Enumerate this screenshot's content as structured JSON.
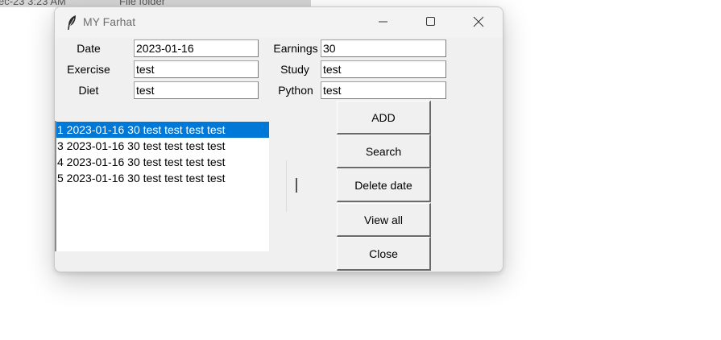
{
  "background": {
    "explorer_date": "ec-23 3:23 AM",
    "explorer_type": "File folder"
  },
  "window": {
    "title": "MY Farhat",
    "controls": {
      "minimize": "minimize-icon",
      "maximize": "maximize-icon",
      "close": "close-icon"
    }
  },
  "form": {
    "date": {
      "label": "Date",
      "value": "2023-01-16"
    },
    "exercise": {
      "label": "Exercise",
      "value": "test"
    },
    "diet": {
      "label": "Diet",
      "value": "test"
    },
    "earnings": {
      "label": "Earnings",
      "value": "30"
    },
    "study": {
      "label": "Study",
      "value": "test"
    },
    "python": {
      "label": "Python",
      "value": "test"
    }
  },
  "listbox": {
    "selected_index": 0,
    "items": [
      "1 2023-01-16 30 test test test test",
      "3 2023-01-16 30 test test test test",
      "4 2023-01-16 30 test test test test",
      "5 2023-01-16 30 test test test test"
    ]
  },
  "buttons": {
    "add": "ADD",
    "search": "Search",
    "delete": "Delete date",
    "view_all": "View all",
    "close": "Close"
  },
  "colors": {
    "selection": "#0078d7",
    "window_bg": "#f0f0f0"
  }
}
